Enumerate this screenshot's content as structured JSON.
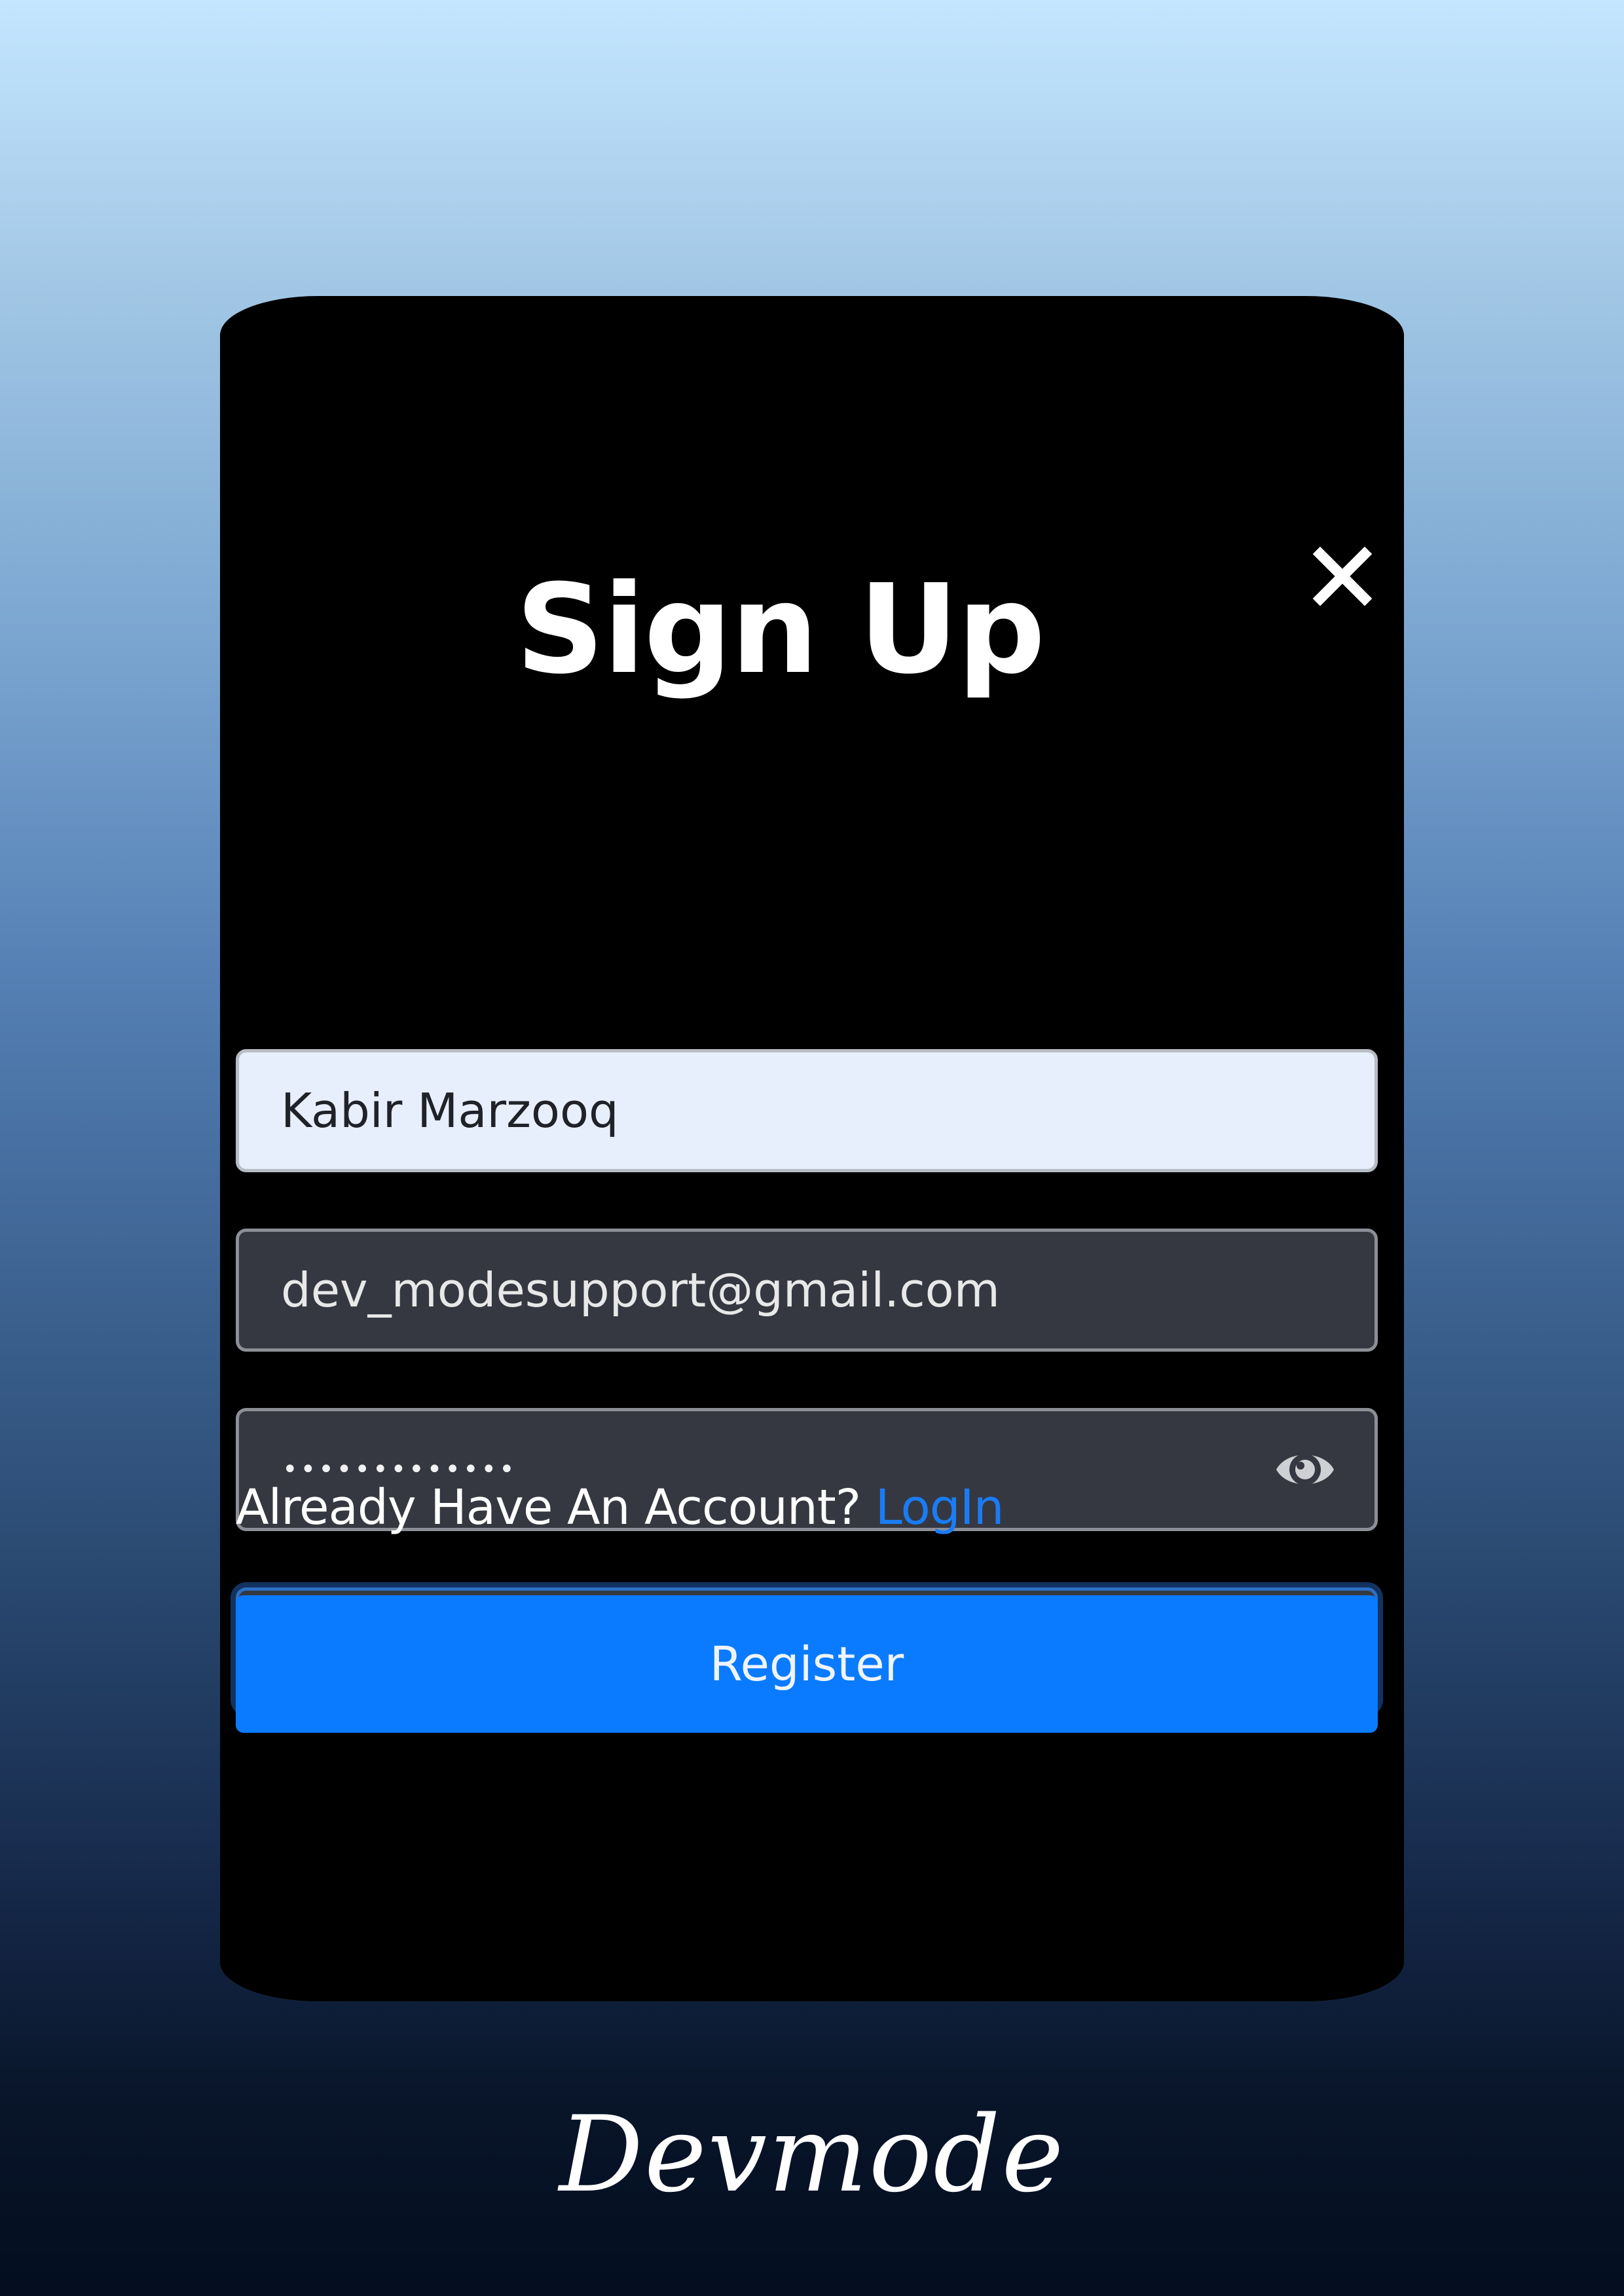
{
  "signup": {
    "title": "Sign Up",
    "close_icon": "close-icon",
    "name_value": "Kabir Marzooq",
    "email_value": "dev_modesupport@gmail.com",
    "password_value": "•••••••••••••",
    "confirm_password_value": "•••••••••••••",
    "eye_icon": "eye-icon",
    "login_prompt": "Already Have An Account? ",
    "login_link": "LogIn",
    "register_label": "Register"
  },
  "brand": {
    "text": "Devmode"
  },
  "colors": {
    "primary_button": "#0a7bff",
    "link": "#1a7cf5",
    "card_background": "#000000",
    "input_background": "#353840",
    "autofill_background": "#e8effc"
  }
}
